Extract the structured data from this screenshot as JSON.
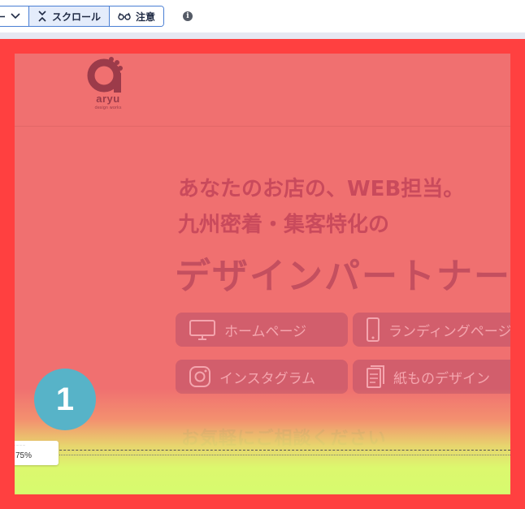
{
  "toolbar": {
    "partial_button_label": "ー",
    "scroll_label": "スクロール",
    "attention_label": "注意",
    "info_glyph": "i",
    "active_tab": "scroll"
  },
  "heatmap": {
    "marker_number": "1",
    "fold_percent": "75%",
    "fold_caption": "… … … …",
    "colors": {
      "frame": "#ff4040",
      "hot": "#f07070",
      "warm": "#e6e66e",
      "cool": "#d7fa6e",
      "marker": "#57b3c8"
    }
  },
  "site": {
    "logo_word": "aryu",
    "logo_sub": "design works",
    "hero_line1": "あなたのお店の、WEB担当。",
    "hero_line2": "九州密着・集客特化の",
    "hero_line3": "デザインパートナー",
    "services": [
      {
        "label": "ホームページ",
        "icon": "monitor-icon"
      },
      {
        "label": "ランディングページ",
        "icon": "smartphone-icon"
      },
      {
        "label": "インスタグラム",
        "icon": "instagram-icon"
      },
      {
        "label": "紙ものデザイン",
        "icon": "document-icon"
      }
    ],
    "consult": "お気軽にご相談ください"
  }
}
